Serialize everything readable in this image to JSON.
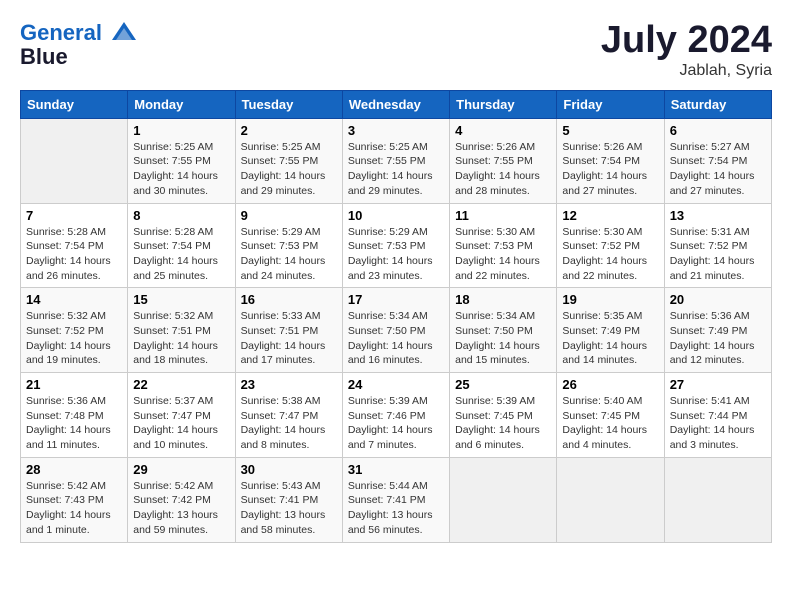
{
  "logo": {
    "line1": "General",
    "line2": "Blue"
  },
  "title": "July 2024",
  "location": "Jablah, Syria",
  "days_of_week": [
    "Sunday",
    "Monday",
    "Tuesday",
    "Wednesday",
    "Thursday",
    "Friday",
    "Saturday"
  ],
  "weeks": [
    [
      {
        "day": "",
        "info": ""
      },
      {
        "day": "1",
        "info": "Sunrise: 5:25 AM\nSunset: 7:55 PM\nDaylight: 14 hours\nand 30 minutes."
      },
      {
        "day": "2",
        "info": "Sunrise: 5:25 AM\nSunset: 7:55 PM\nDaylight: 14 hours\nand 29 minutes."
      },
      {
        "day": "3",
        "info": "Sunrise: 5:25 AM\nSunset: 7:55 PM\nDaylight: 14 hours\nand 29 minutes."
      },
      {
        "day": "4",
        "info": "Sunrise: 5:26 AM\nSunset: 7:55 PM\nDaylight: 14 hours\nand 28 minutes."
      },
      {
        "day": "5",
        "info": "Sunrise: 5:26 AM\nSunset: 7:54 PM\nDaylight: 14 hours\nand 27 minutes."
      },
      {
        "day": "6",
        "info": "Sunrise: 5:27 AM\nSunset: 7:54 PM\nDaylight: 14 hours\nand 27 minutes."
      }
    ],
    [
      {
        "day": "7",
        "info": "Sunrise: 5:28 AM\nSunset: 7:54 PM\nDaylight: 14 hours\nand 26 minutes."
      },
      {
        "day": "8",
        "info": "Sunrise: 5:28 AM\nSunset: 7:54 PM\nDaylight: 14 hours\nand 25 minutes."
      },
      {
        "day": "9",
        "info": "Sunrise: 5:29 AM\nSunset: 7:53 PM\nDaylight: 14 hours\nand 24 minutes."
      },
      {
        "day": "10",
        "info": "Sunrise: 5:29 AM\nSunset: 7:53 PM\nDaylight: 14 hours\nand 23 minutes."
      },
      {
        "day": "11",
        "info": "Sunrise: 5:30 AM\nSunset: 7:53 PM\nDaylight: 14 hours\nand 22 minutes."
      },
      {
        "day": "12",
        "info": "Sunrise: 5:30 AM\nSunset: 7:52 PM\nDaylight: 14 hours\nand 22 minutes."
      },
      {
        "day": "13",
        "info": "Sunrise: 5:31 AM\nSunset: 7:52 PM\nDaylight: 14 hours\nand 21 minutes."
      }
    ],
    [
      {
        "day": "14",
        "info": "Sunrise: 5:32 AM\nSunset: 7:52 PM\nDaylight: 14 hours\nand 19 minutes."
      },
      {
        "day": "15",
        "info": "Sunrise: 5:32 AM\nSunset: 7:51 PM\nDaylight: 14 hours\nand 18 minutes."
      },
      {
        "day": "16",
        "info": "Sunrise: 5:33 AM\nSunset: 7:51 PM\nDaylight: 14 hours\nand 17 minutes."
      },
      {
        "day": "17",
        "info": "Sunrise: 5:34 AM\nSunset: 7:50 PM\nDaylight: 14 hours\nand 16 minutes."
      },
      {
        "day": "18",
        "info": "Sunrise: 5:34 AM\nSunset: 7:50 PM\nDaylight: 14 hours\nand 15 minutes."
      },
      {
        "day": "19",
        "info": "Sunrise: 5:35 AM\nSunset: 7:49 PM\nDaylight: 14 hours\nand 14 minutes."
      },
      {
        "day": "20",
        "info": "Sunrise: 5:36 AM\nSunset: 7:49 PM\nDaylight: 14 hours\nand 12 minutes."
      }
    ],
    [
      {
        "day": "21",
        "info": "Sunrise: 5:36 AM\nSunset: 7:48 PM\nDaylight: 14 hours\nand 11 minutes."
      },
      {
        "day": "22",
        "info": "Sunrise: 5:37 AM\nSunset: 7:47 PM\nDaylight: 14 hours\nand 10 minutes."
      },
      {
        "day": "23",
        "info": "Sunrise: 5:38 AM\nSunset: 7:47 PM\nDaylight: 14 hours\nand 8 minutes."
      },
      {
        "day": "24",
        "info": "Sunrise: 5:39 AM\nSunset: 7:46 PM\nDaylight: 14 hours\nand 7 minutes."
      },
      {
        "day": "25",
        "info": "Sunrise: 5:39 AM\nSunset: 7:45 PM\nDaylight: 14 hours\nand 6 minutes."
      },
      {
        "day": "26",
        "info": "Sunrise: 5:40 AM\nSunset: 7:45 PM\nDaylight: 14 hours\nand 4 minutes."
      },
      {
        "day": "27",
        "info": "Sunrise: 5:41 AM\nSunset: 7:44 PM\nDaylight: 14 hours\nand 3 minutes."
      }
    ],
    [
      {
        "day": "28",
        "info": "Sunrise: 5:42 AM\nSunset: 7:43 PM\nDaylight: 14 hours\nand 1 minute."
      },
      {
        "day": "29",
        "info": "Sunrise: 5:42 AM\nSunset: 7:42 PM\nDaylight: 13 hours\nand 59 minutes."
      },
      {
        "day": "30",
        "info": "Sunrise: 5:43 AM\nSunset: 7:41 PM\nDaylight: 13 hours\nand 58 minutes."
      },
      {
        "day": "31",
        "info": "Sunrise: 5:44 AM\nSunset: 7:41 PM\nDaylight: 13 hours\nand 56 minutes."
      },
      {
        "day": "",
        "info": ""
      },
      {
        "day": "",
        "info": ""
      },
      {
        "day": "",
        "info": ""
      }
    ]
  ]
}
